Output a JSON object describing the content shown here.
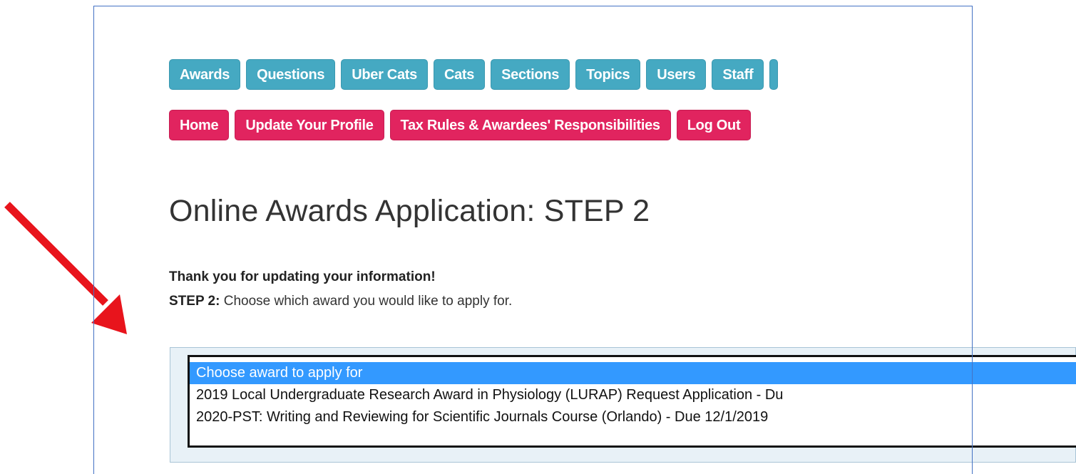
{
  "nav": {
    "admin_items": [
      "Awards",
      "Questions",
      "Uber Cats",
      "Cats",
      "Sections",
      "Topics",
      "Users",
      "Staff"
    ],
    "user_items": [
      "Home",
      "Update Your Profile",
      "Tax Rules & Awardees' Responsibilities",
      "Log Out"
    ]
  },
  "main": {
    "title": "Online Awards Application: STEP 2",
    "thanks": "Thank you for updating your information!",
    "step_label": "STEP 2:",
    "step_text": " Choose which award you would like to apply for."
  },
  "award_select": {
    "options": [
      "Choose award to apply for",
      "2019 Local Undergraduate Research Award in Physiology (LURAP) Request Application - Du",
      "2020-PST: Writing and Reviewing for Scientific Journals Course (Orlando) - Due 12/1/2019"
    ],
    "selected_index": 0
  },
  "colors": {
    "admin_nav": "#45a9c2",
    "user_nav": "#e1245f",
    "selected_option": "#3399ff",
    "annotation_arrow": "#e8141c",
    "annotation_frame": "#4472c4"
  }
}
